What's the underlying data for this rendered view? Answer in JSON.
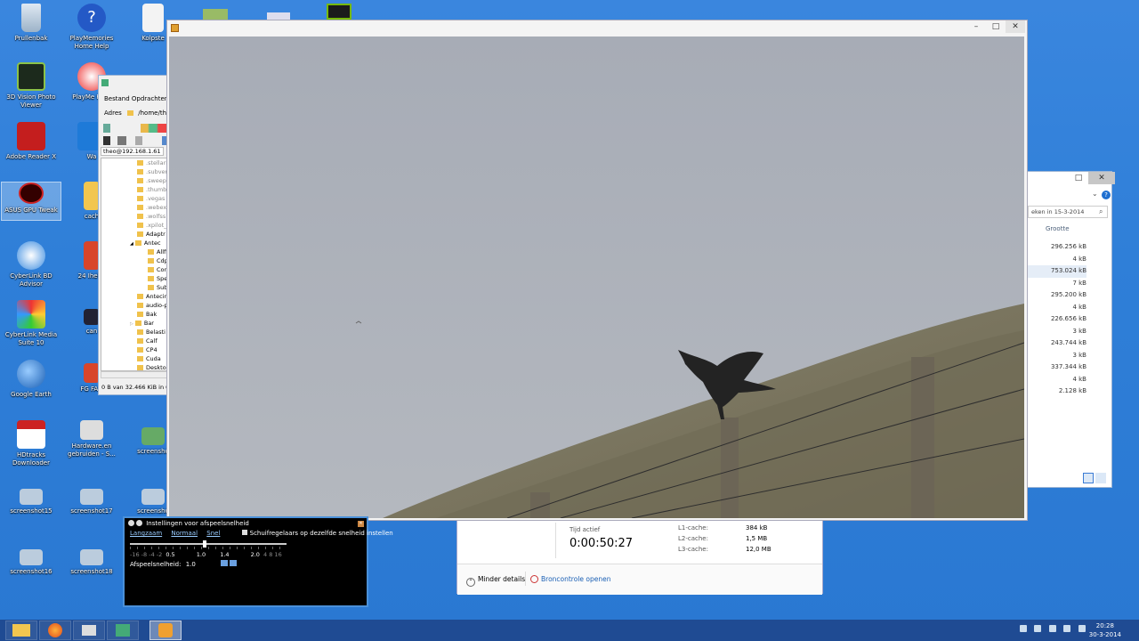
{
  "desktop": {
    "icons": [
      {
        "label": "Prullenbak"
      },
      {
        "label": "PlayMemories Home Help"
      },
      {
        "label": "Kolpste"
      },
      {
        "label": "3D Vision Photo Viewer"
      },
      {
        "label": "PlayMe Hom"
      },
      {
        "label": "Adobe Reader X"
      },
      {
        "label": "Wa"
      },
      {
        "label": "ASUS GPU Tweak"
      },
      {
        "label": "cach"
      },
      {
        "label": "CyberLink BD Advisor"
      },
      {
        "label": "24 Ihebe"
      },
      {
        "label": "CyberLink Media Suite 10"
      },
      {
        "label": "can"
      },
      {
        "label": "Google Earth"
      },
      {
        "label": "FG FAO"
      },
      {
        "label": "HDtracks Downloader"
      },
      {
        "label": "Hardware.en gebruiden - S..."
      },
      {
        "label": "screensho"
      },
      {
        "label": "screenshot15"
      },
      {
        "label": "screenshot17"
      },
      {
        "label": "screensho"
      },
      {
        "label": "screenshot16"
      },
      {
        "label": "screenshot18"
      }
    ]
  },
  "file_manager": {
    "menu": "Bestand  Opdrachten",
    "address_label": "Adres",
    "address_value": "/home/the",
    "session_tab": "theo@192.168.1.61",
    "tree": [
      ".stellari",
      ".subversi",
      ".sweep",
      ".thumbn",
      ".vegas",
      ".webex",
      ".wolfss",
      ".xpilot_",
      "Adaptr",
      "Antec",
      "Allfi",
      "Cdp",
      "Con",
      "Spe",
      "Sub",
      "Antecin",
      "audio-p",
      "Bak",
      "Bar",
      "Belasti",
      "Calf",
      "CP4",
      "Cuda",
      "Deskto"
    ],
    "status": "0 B van 32.466 KiB in 0 va"
  },
  "explorer": {
    "search_placeholder": "eken in 15-3-2014",
    "column_header": "Grootte",
    "sizes": [
      "296.256 kB",
      "4 kB",
      "753.024 kB",
      "7 kB",
      "295.200 kB",
      "4 kB",
      "226.656 kB",
      "3 kB",
      "243.744 kB",
      "3 kB",
      "337.344 kB",
      "4 kB",
      "2.128 kB"
    ],
    "highlight_index": 2
  },
  "task_manager": {
    "uptime_label": "Tijd actief",
    "uptime_value": "0:00:50:27",
    "cache_labels": [
      "L1-cache:",
      "L2-cache:",
      "L3-cache:"
    ],
    "cache_values": [
      "384 kB",
      "1,5 MB",
      "12,0 MB"
    ],
    "fewer_details": "Minder details",
    "open_monitor": "Broncontrole openen"
  },
  "speed_dialog": {
    "title": "Instellingen voor afspeelsnelheid",
    "slow": "Langzaam",
    "normal": "Normaal",
    "fast": "Snel",
    "sync_label": "Schuifregelaars op dezelfde snelheid instellen",
    "ticks_dim": "-16 -8 -4 -2",
    "tick_05": "0.5",
    "tick_10": "1.0",
    "tick_14": "1.4",
    "tick_20": "2.0",
    "ticks_dim2": "4 8 16",
    "rate_label": "Afspeelsnelheid:",
    "rate_value": "1.0"
  },
  "taskbar": {
    "clock_time": "20:28",
    "clock_date": "30-3-2014"
  }
}
